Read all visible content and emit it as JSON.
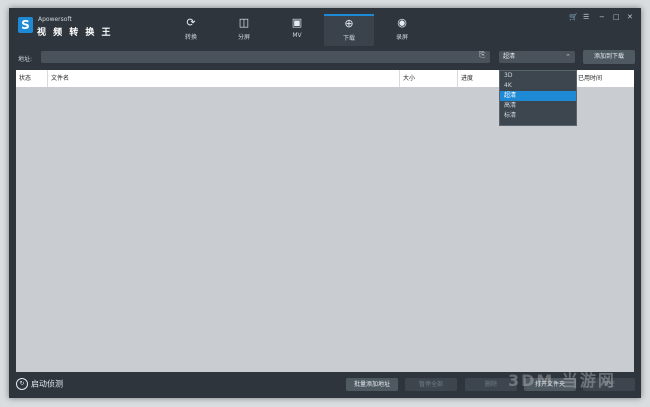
{
  "app": {
    "brand": "Apowersoft",
    "name": "视 频 转 换 王"
  },
  "tabs": [
    {
      "label": "转换",
      "icon": "refresh-icon"
    },
    {
      "label": "分屏",
      "icon": "split-screen-icon"
    },
    {
      "label": "MV",
      "icon": "tv-icon"
    },
    {
      "label": "下载",
      "icon": "download-icon"
    },
    {
      "label": "录屏",
      "icon": "record-icon"
    }
  ],
  "window_controls": [
    "cart-icon",
    "menu-icon",
    "minimize-icon",
    "maximize-icon",
    "close-icon"
  ],
  "address": {
    "label": "地址:",
    "value": ""
  },
  "quality": {
    "selected": "超清",
    "options": [
      "3D",
      "4K",
      "超清",
      "高清",
      "标清"
    ]
  },
  "add_download_label": "添加到下载",
  "table": {
    "columns": [
      "状态",
      "文件名",
      "大小",
      "进度",
      "",
      "已用时间"
    ]
  },
  "bottom": {
    "start_detect": "启动侦测",
    "batch_add": "批量添加地址",
    "pause_all": "暂停全部",
    "delete": "删除",
    "open_folder": "打开文件夹",
    "clear": "清空"
  },
  "watermark": "3DM 当游网"
}
